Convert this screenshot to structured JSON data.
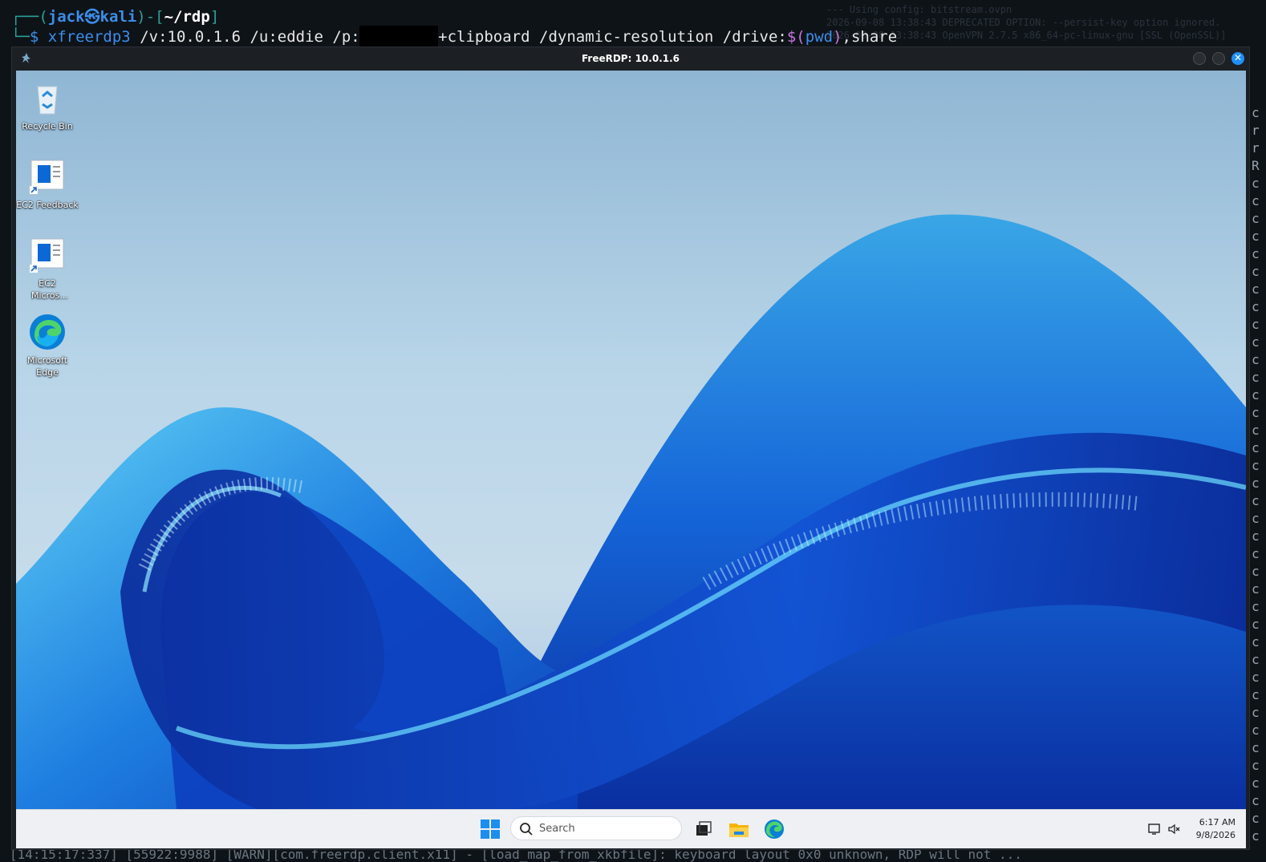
{
  "terminal": {
    "prompt_open": "┌──(",
    "user": "jack㉿kali",
    "prompt_mid": ")-[",
    "cwd": "~/rdp",
    "prompt_close": "]",
    "line2_prefix": "└─",
    "dollar": "$",
    "command": "xfreerdp3",
    "args_part1": " /v:10.0.1.6 /u:eddie /p:s",
    "args_part2": "+clipboard /dynamic-resolution /drive:",
    "subst_open": "$(",
    "subst_cmd": "pwd",
    "subst_close": ")",
    "args_part3": ",share",
    "bg_log_1": "--- Using config: bitstream.ovpn",
    "bg_log_2": "2026-09-08 13:38:43 DEPRECATED OPTION: --persist-key option ignored.",
    "bg_log_3": "2026-09-08 13:38:43 OpenVPN 2.7.5 x86_64-pc-linux-gnu [SSL (OpenSSL)]",
    "right_col": "c\nr\nr\nR\nc\nc\nc\nc\nc\nc\nc\nc\nc\nc\nc\nc\nc\nc\nc\nc\nc\nc\nc\nc\nc\nc\nc\nc\nc\nc\nc\nc\nc\nc\nc\nc\nc\nc\nc\nc\nc\nc",
    "bottom_line": "[14:15:17:337] [55922:9988] [WARN][com.freerdp.client.x11] - [load_map_from_xkbfile]: keyboard layout 0x0 unknown, RDP will not ..."
  },
  "window": {
    "title": "FreeRDP: 10.0.1.6"
  },
  "desktop_icons": [
    {
      "label": "Recycle Bin",
      "icon": "recycle-bin-icon"
    },
    {
      "label": "EC2 Feedback",
      "icon": "ec2-feedback-icon"
    },
    {
      "label": "EC2 Micros...",
      "icon": "ec2-microsoft-icon"
    },
    {
      "label": "Microsoft Edge",
      "icon": "edge-icon"
    }
  ],
  "taskbar": {
    "search_placeholder": "Search",
    "time": "6:17 AM",
    "date": "9/8/2026"
  },
  "colors": {
    "accent": "#1e90ff",
    "terminal_bg": "#0e1318",
    "taskbar_bg": "#eef0f3"
  }
}
